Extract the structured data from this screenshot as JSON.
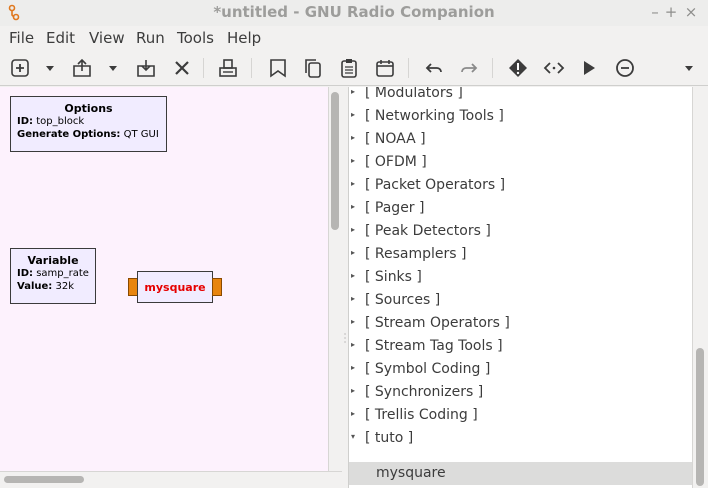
{
  "window": {
    "title": "*untitled - GNU Radio Companion",
    "minimize": "–",
    "maximize": "+",
    "close": "×"
  },
  "menu": [
    "File",
    "Edit",
    "View",
    "Run",
    "Tools",
    "Help"
  ],
  "toolbar": {
    "icons": [
      "new-icon",
      "open-icon",
      "save-icon",
      "close-icon",
      "print-icon",
      "screenshot-icon",
      "copy-icon",
      "paste-icon",
      "properties-icon",
      "undo-icon",
      "redo-icon",
      "errors-icon",
      "generate-icon",
      "execute-icon",
      "kill-icon",
      "more-icon"
    ]
  },
  "canvas": {
    "options_block": {
      "title": "Options",
      "id_label": "ID:",
      "id_value": "top_block",
      "gen_label": "Generate Options:",
      "gen_value": "QT GUI"
    },
    "variable_block": {
      "title": "Variable",
      "id_label": "ID:",
      "id_value": "samp_rate",
      "value_label": "Value:",
      "value_value": "32k"
    },
    "custom_block": {
      "title": "mysquare"
    }
  },
  "tree": {
    "items": [
      {
        "label": "[ Modulators ]",
        "expanded": false
      },
      {
        "label": "[ Networking Tools ]",
        "expanded": false
      },
      {
        "label": "[ NOAA ]",
        "expanded": false
      },
      {
        "label": "[ OFDM ]",
        "expanded": false
      },
      {
        "label": "[ Packet Operators ]",
        "expanded": false
      },
      {
        "label": "[ Pager ]",
        "expanded": false
      },
      {
        "label": "[ Peak Detectors ]",
        "expanded": false
      },
      {
        "label": "[ Resamplers ]",
        "expanded": false
      },
      {
        "label": "[ Sinks ]",
        "expanded": false
      },
      {
        "label": "[ Sources ]",
        "expanded": false
      },
      {
        "label": "[ Stream Operators ]",
        "expanded": false
      },
      {
        "label": "[ Stream Tag Tools ]",
        "expanded": false
      },
      {
        "label": "[ Symbol Coding ]",
        "expanded": false
      },
      {
        "label": "[ Synchronizers ]",
        "expanded": false
      },
      {
        "label": "[ Trellis Coding ]",
        "expanded": false
      },
      {
        "label": "[ tuto ]",
        "expanded": true
      }
    ],
    "child": {
      "label": "mysquare",
      "selected": true
    }
  },
  "colors": {
    "canvas_bg": "#fdf2fd",
    "block_bg": "#f1ecff",
    "port": "#e8850f",
    "custom_block_text": "#e60000"
  }
}
